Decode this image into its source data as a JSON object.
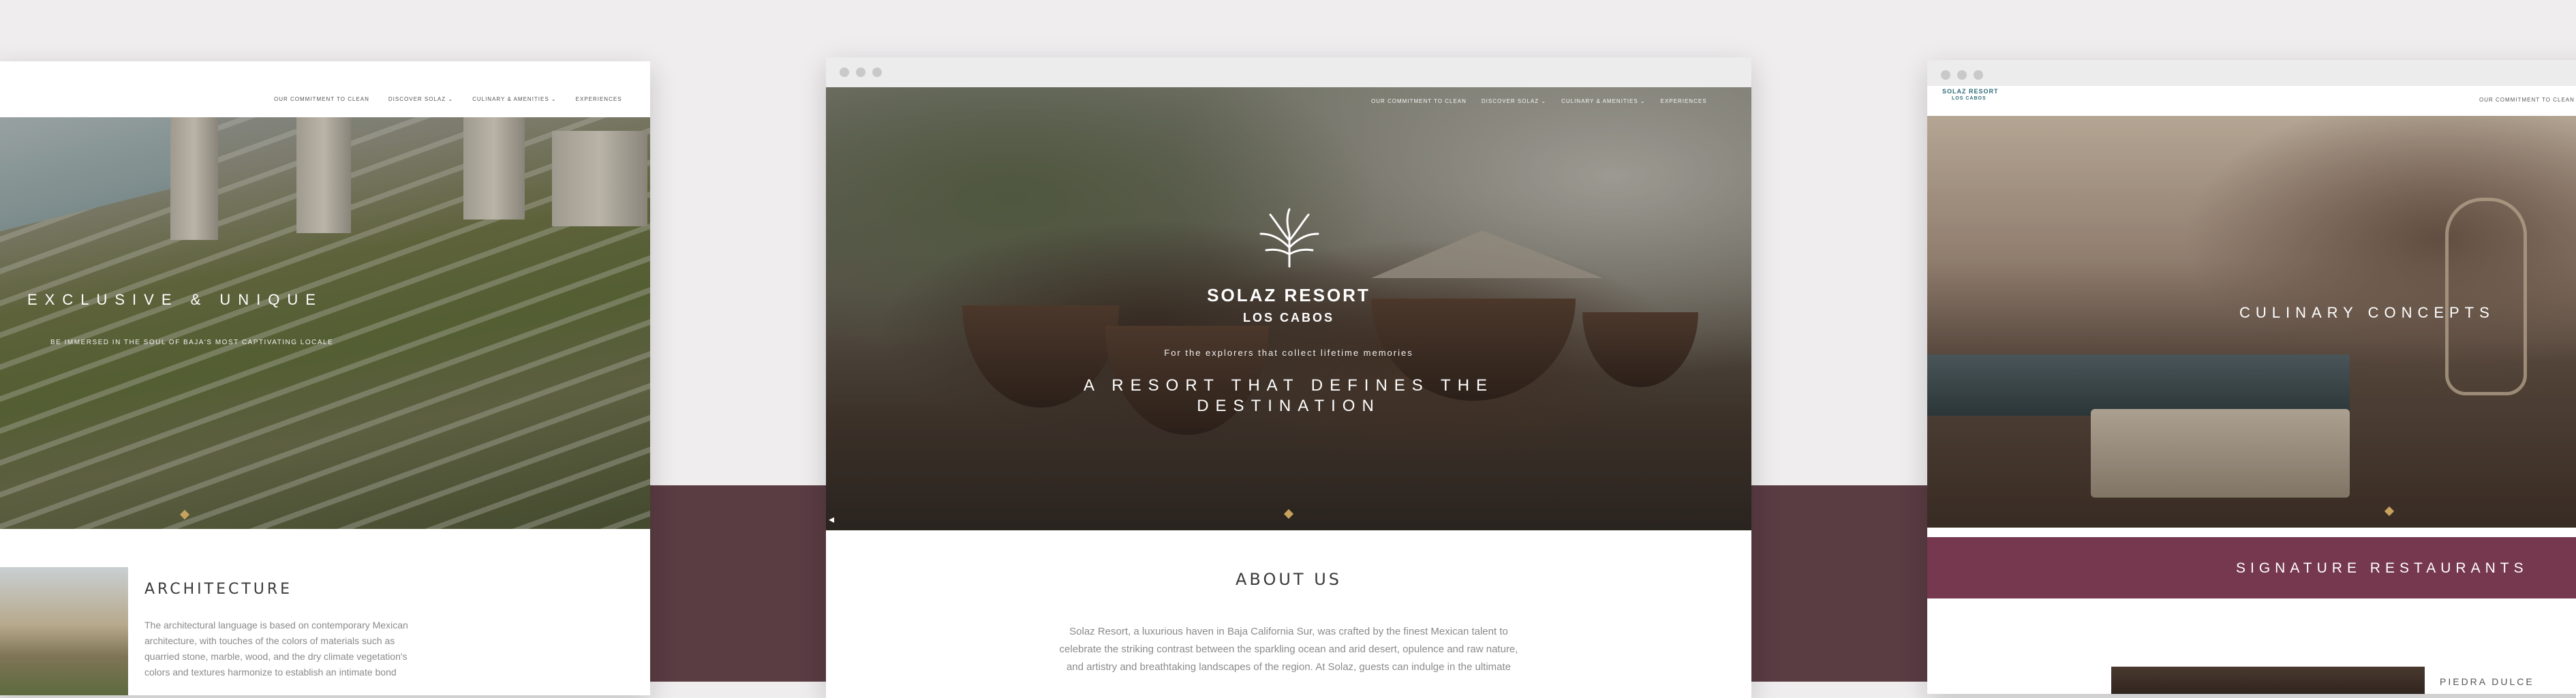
{
  "left": {
    "nav": [
      "OUR COMMITMENT TO CLEAN",
      "DISCOVER SOLAZ ⌄",
      "CULINARY & AMENITIES ⌄",
      "EXPERIENCES"
    ],
    "hero_title": "EXCLUSIVE & UNIQUE",
    "hero_subtitle": "BE IMMERSED IN THE SOUL OF BAJA'S MOST CAPTIVATING LOCALE",
    "section_title": "ARCHITECTURE",
    "section_text": [
      "The architectural language is based on contemporary Mexican",
      "architecture, with touches of the colors of materials such as",
      "quarried stone, marble, wood, and the dry climate vegetation's",
      "colors and textures harmonize to establish an intimate bond"
    ]
  },
  "center": {
    "nav": [
      "OUR COMMITMENT TO CLEAN",
      "DISCOVER SOLAZ ⌄",
      "CULINARY & AMENITIES ⌄",
      "EXPERIENCES"
    ],
    "brand_name": "SOLAZ RESORT",
    "brand_location": "LOS CABOS",
    "tagline": "For the explorers that collect lifetime memories",
    "headline_1": "A RESORT THAT DEFINES THE",
    "headline_2": "DESTINATION",
    "section_title": "ABOUT US",
    "section_text": [
      "Solaz Resort, a luxurious haven in Baja California Sur, was crafted by the finest Mexican talent to",
      "celebrate the striking contrast between the sparkling ocean and arid desert, opulence and raw nature,",
      "and artistry and breathtaking landscapes of the region. At Solaz, guests can indulge in the ultimate"
    ],
    "arrow": "◂"
  },
  "right": {
    "brand_name": "SOLAZ RESORT",
    "brand_location": "LOS CABOS",
    "nav": [
      "OUR COMMITMENT TO CLEAN"
    ],
    "hero_title": "CULINARY CONCEPTS",
    "band_title": "SIGNATURE RESTAURANTS",
    "teaser": "PIEDRA DULCE"
  },
  "colors": {
    "background": "#efedee",
    "band": "#5a3c43",
    "accent_band": "#76384f",
    "diamond": "#c7a25d"
  }
}
